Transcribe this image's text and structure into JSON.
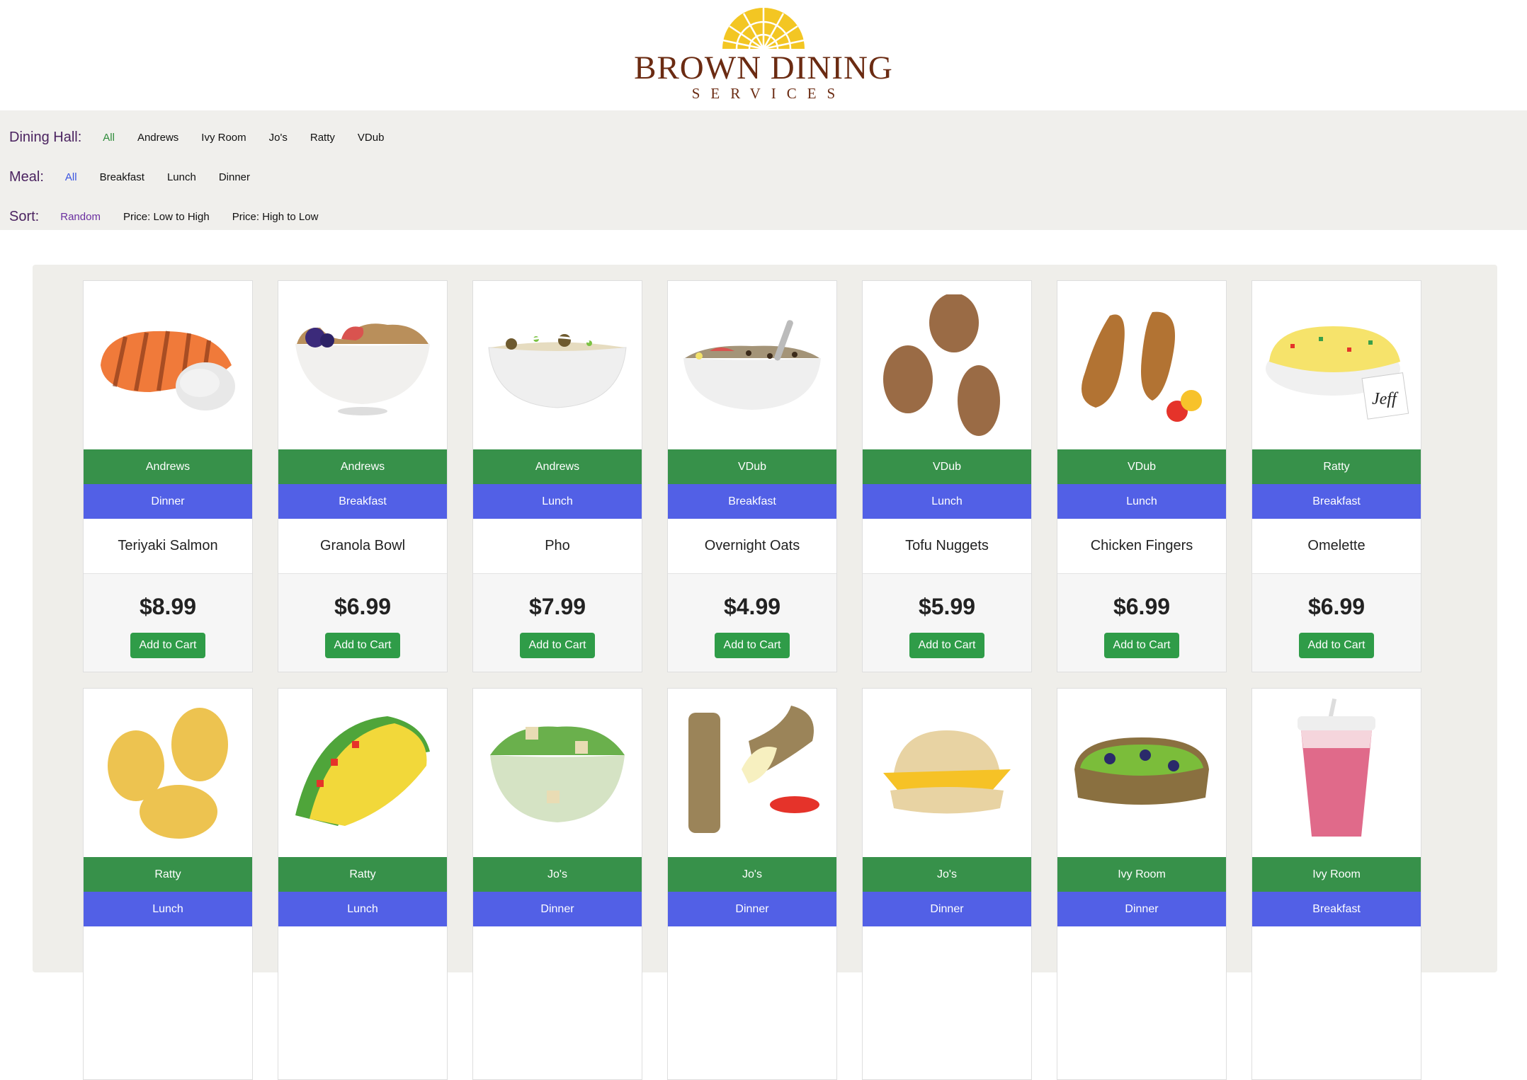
{
  "logo": {
    "title": "BROWN DINING",
    "subtitle": "SERVICES"
  },
  "filters": {
    "hall": {
      "label": "Dining Hall:",
      "options": [
        "All",
        "Andrews",
        "Ivy Room",
        "Jo's",
        "Ratty",
        "VDub"
      ],
      "selected": "All"
    },
    "meal": {
      "label": "Meal:",
      "options": [
        "All",
        "Breakfast",
        "Lunch",
        "Dinner"
      ],
      "selected": "All"
    },
    "sort": {
      "label": "Sort:",
      "options": [
        "Random",
        "Price: Low to High",
        "Price: High to Low"
      ],
      "selected": "Random"
    }
  },
  "colors": {
    "hall_bar": "#37914a",
    "meal_bar": "#5260e6",
    "button": "#2f9c48"
  },
  "add_to_cart_label": "Add to Cart",
  "items": [
    {
      "name": "Teriyaki Salmon",
      "hall": "Andrews",
      "meal": "Dinner",
      "price": "$8.99",
      "icon": "salmon-icon"
    },
    {
      "name": "Granola Bowl",
      "hall": "Andrews",
      "meal": "Breakfast",
      "price": "$6.99",
      "icon": "granola-bowl-icon"
    },
    {
      "name": "Pho",
      "hall": "Andrews",
      "meal": "Lunch",
      "price": "$7.99",
      "icon": "pho-icon"
    },
    {
      "name": "Overnight Oats",
      "hall": "VDub",
      "meal": "Breakfast",
      "price": "$4.99",
      "icon": "oats-icon"
    },
    {
      "name": "Tofu Nuggets",
      "hall": "VDub",
      "meal": "Lunch",
      "price": "$5.99",
      "icon": "nuggets-icon"
    },
    {
      "name": "Chicken Fingers",
      "hall": "VDub",
      "meal": "Lunch",
      "price": "$6.99",
      "icon": "chicken-fingers-icon"
    },
    {
      "name": "Omelette",
      "hall": "Ratty",
      "meal": "Breakfast",
      "price": "$6.99",
      "icon": "omelette-icon",
      "sticker": "Jeff"
    },
    {
      "name": "",
      "hall": "Ratty",
      "meal": "Lunch",
      "price": "",
      "icon": "potatoes-icon"
    },
    {
      "name": "",
      "hall": "Ratty",
      "meal": "Lunch",
      "price": "",
      "icon": "taco-icon"
    },
    {
      "name": "",
      "hall": "Jo's",
      "meal": "Dinner",
      "price": "",
      "icon": "salad-icon"
    },
    {
      "name": "",
      "hall": "Jo's",
      "meal": "Dinner",
      "price": "",
      "icon": "mozzarella-sticks-icon"
    },
    {
      "name": "",
      "hall": "Jo's",
      "meal": "Dinner",
      "price": "",
      "icon": "burger-icon"
    },
    {
      "name": "",
      "hall": "Ivy Room",
      "meal": "Dinner",
      "price": "",
      "icon": "avocado-toast-icon"
    },
    {
      "name": "",
      "hall": "Ivy Room",
      "meal": "Breakfast",
      "price": "",
      "icon": "smoothie-icon"
    }
  ]
}
